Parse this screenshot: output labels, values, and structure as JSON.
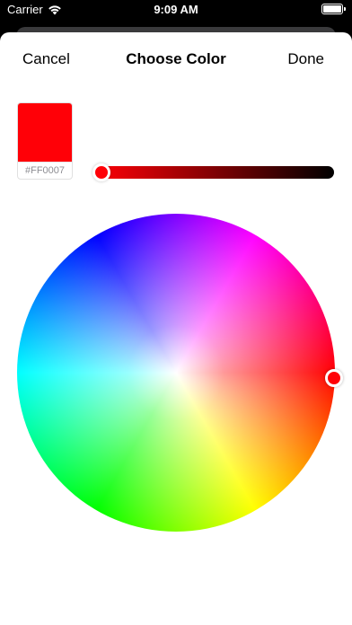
{
  "status_bar": {
    "carrier": "Carrier",
    "time": "9:09 AM",
    "wifi_icon": "wifi-icon",
    "battery_icon": "battery-icon"
  },
  "nav": {
    "cancel_label": "Cancel",
    "title": "Choose Color",
    "done_label": "Done"
  },
  "color": {
    "swatch_color": "#FF0007",
    "hex_label": "#FF0007",
    "brightness": 1.0,
    "hue_degrees": 358,
    "saturation": 1.0
  },
  "colors": {
    "sheet_background": "#FFFFFF",
    "screen_background": "#000000",
    "back_card": "#3A3A3C",
    "slider_dark_end": "#000000",
    "hex_text": "#8E8E93"
  }
}
